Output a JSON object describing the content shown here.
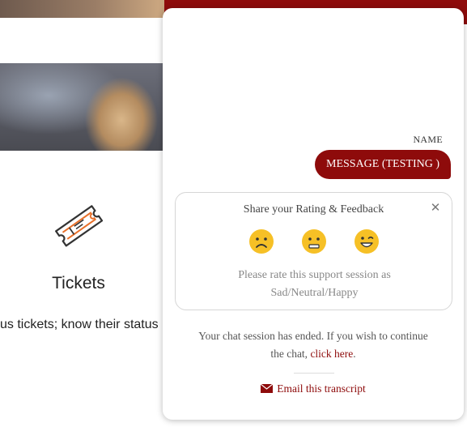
{
  "page": {
    "tickets_title": "Tickets",
    "tickets_desc": "us tickets; know their status"
  },
  "chat": {
    "name_label": "NAME",
    "message": "MESSAGE (TESTING )",
    "rating": {
      "title": "Share your Rating & Feedback",
      "close_glyph": "✕",
      "emojis": [
        "sad-emoji-icon",
        "neutral-emoji-icon",
        "happy-emoji-icon"
      ],
      "desc_line1": "Please rate this support session as",
      "desc_line2": "Sad/Neutral/Happy"
    },
    "ended": {
      "line1": "Your chat session has ended. If you wish to continue",
      "line2_prefix": "the chat, ",
      "link": "click here",
      "line2_suffix": "."
    },
    "email_transcript": "Email this transcript"
  },
  "colors": {
    "brand": "#8e0b0b",
    "emoji_yellow": "#f6c026",
    "icon_orange": "#e8702a"
  }
}
